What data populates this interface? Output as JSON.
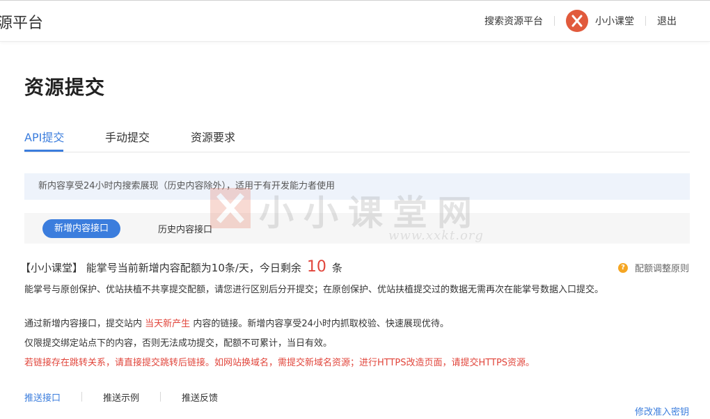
{
  "header": {
    "brand_fragment": "源平台",
    "search_platform_link": "搜索资源平台",
    "username": "小小课堂",
    "logout": "退出"
  },
  "page": {
    "title": "资源提交"
  },
  "tabs": [
    {
      "label": "API提交",
      "active": true
    },
    {
      "label": "手动提交",
      "active": false
    },
    {
      "label": "资源要求",
      "active": false
    }
  ],
  "notice": "新内容享受24小时内搜索展现（历史内容除外），适用于有开发能力者使用",
  "subtabs": {
    "active": "新增内容接口",
    "other": "历史内容接口"
  },
  "watermark": {
    "text": "小小课堂网",
    "url": "www.xxkt.org"
  },
  "quota": {
    "prefix": "【小小课堂】 能掌号当前新增内容配额为10条/天，今日剩余",
    "remaining": "10",
    "suffix": "条",
    "help_label": "配额调整原则"
  },
  "descriptions": {
    "line1": "能掌号与原创保护、优站扶植不共享提交配额，请您进行区别后分开提交；在原创保护、优站扶植提交过的数据无需再次在能掌号数据入口提交。",
    "line2_a": "通过新增内容接口，提交站内",
    "line2_highlight": "当天新产生",
    "line2_b": "内容的链接。新增内容享受24小时内抓取校验、快速展现优待。",
    "line3": "仅限提交绑定站点下的内容，否则无法成功提交，配额不可累计，当日有效。",
    "line4_warning": "若链接存在跳转关系，请直接提交跳转后链接。如网站换域名，需提交新域名资源；进行HTTPS改造页面，请提交HTTPS资源。"
  },
  "bottom_links": [
    {
      "label": "推送接口",
      "active": true
    },
    {
      "label": "推送示例",
      "active": false
    },
    {
      "label": "推送反馈",
      "active": false
    }
  ],
  "modify_key_link": "修改准入密钥",
  "colors": {
    "accent": "#3b7ddd",
    "warning": "#e1453b",
    "avatar": "#e15a3c",
    "help": "#f5a623"
  }
}
